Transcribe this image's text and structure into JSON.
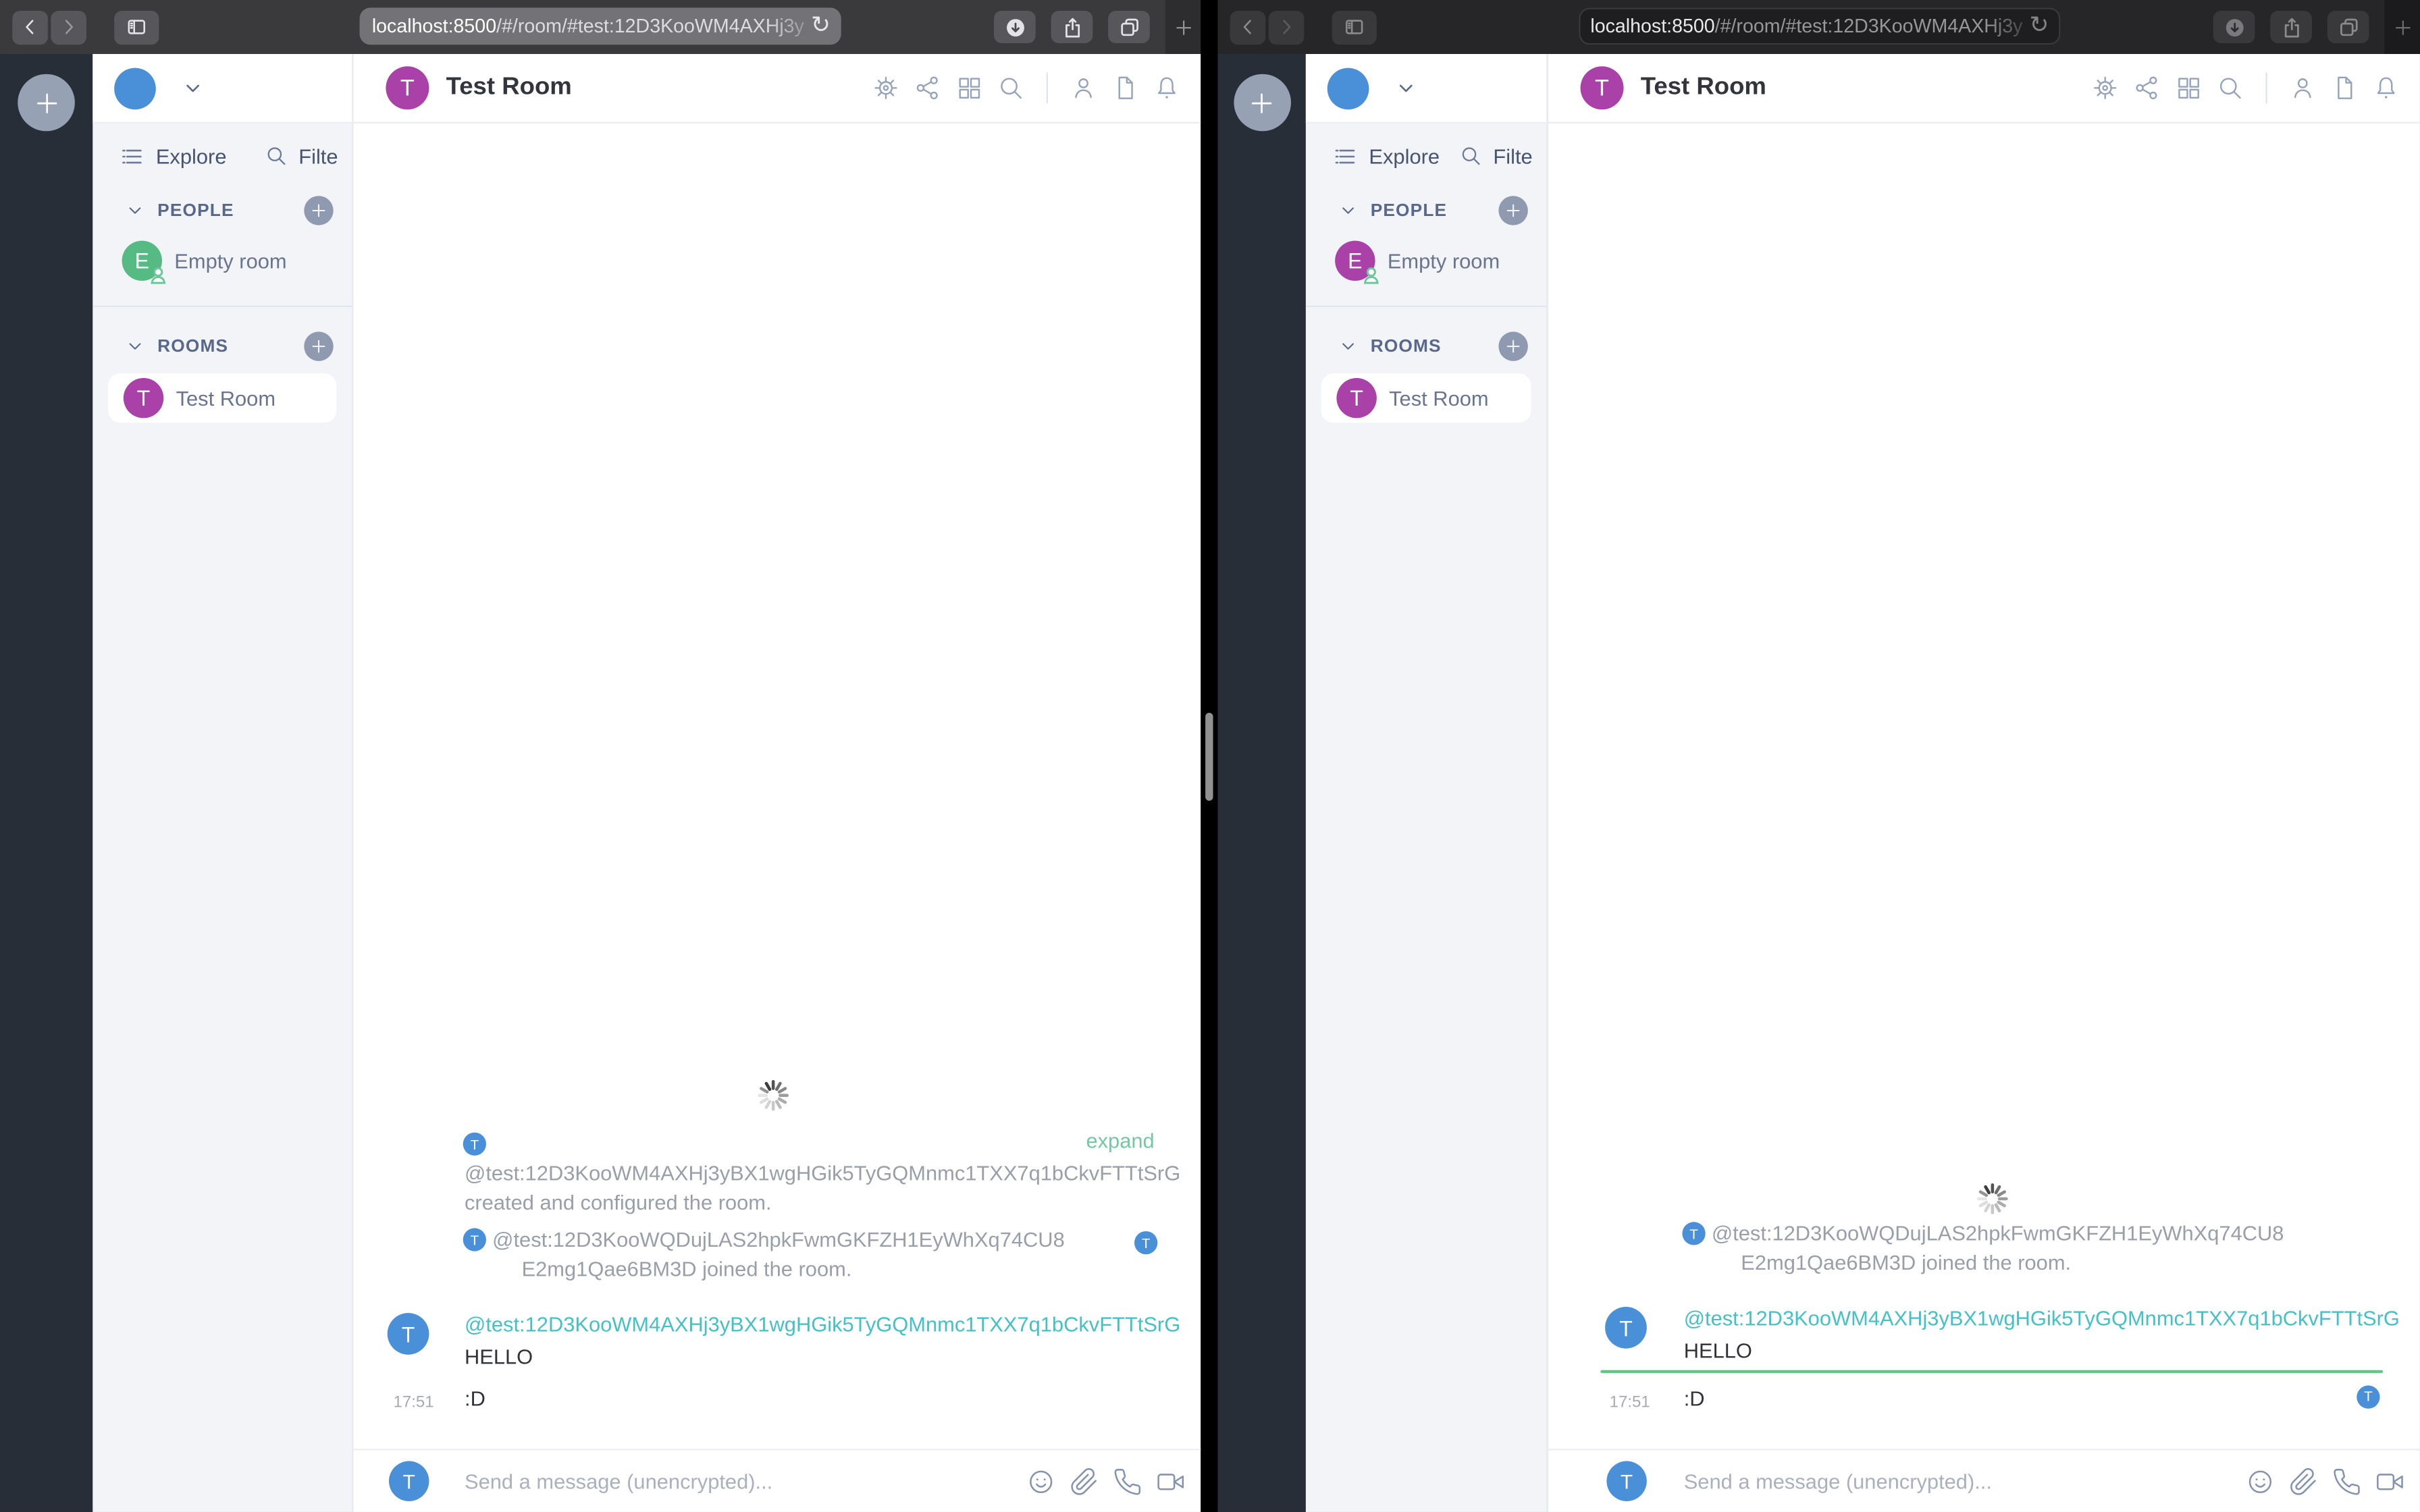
{
  "chrome": {
    "url_prefix": "localhost:8500",
    "url_rest": "/#/room/#test:12D3KooWM4AXHj3y",
    "reload_glyph": "↻"
  },
  "colors": {
    "avatar_blue": "#4a90d9",
    "avatar_purple": "#aa41a8",
    "avatar_green": "#55bb83",
    "sender_teal": "#45c1c5",
    "expand_green": "#74c9a3",
    "unread_marker_green": "#63c687",
    "sidebar_bg": "#f2f4f8",
    "rail_bg": "#282e38"
  },
  "windows": [
    {
      "side": "left",
      "sidebar": {
        "explore_label": "Explore",
        "filter_label": "Filte",
        "people_label": "PEOPLE",
        "rooms_label": "ROOMS",
        "dm": {
          "name": "Empty room",
          "avatar_letter": "E",
          "avatar_color": "#55bb83"
        },
        "room": {
          "name": "Test Room",
          "avatar_letter": "T",
          "avatar_color": "#aa41a8"
        }
      },
      "header": {
        "room_name": "Test Room",
        "avatar_letter": "T"
      },
      "timeline": {
        "created_event": {
          "avatar_letter": "T",
          "expand_label": "expand",
          "line1": "@test:12D3KooWM4AXHj3yBX1wgHGik5TyGQMnmc1TXX7q1bCkvFTTtSrG",
          "line2": "created and configured the room."
        },
        "join_event": {
          "avatar_letter": "T",
          "line1": "@test:12D3KooWQDujLAS2hpkFwmGKFZH1EyWhXq74CU8",
          "line2": "E2mg1Qae6BM3D joined the room.",
          "receipt_letter": "T"
        },
        "message": {
          "avatar_letter": "T",
          "sender": "@test:12D3KooWM4AXHj3yBX1wgHGik5TyGQMnmc1TXX7q1bCkvFTTtSrG",
          "body": "HELLO"
        },
        "message2": {
          "time": "17:51",
          "body": ":D"
        }
      },
      "composer": {
        "avatar_letter": "T",
        "placeholder": "Send a message (unencrypted)..."
      }
    },
    {
      "side": "right",
      "sidebar": {
        "explore_label": "Explore",
        "filter_label": "Filte",
        "people_label": "PEOPLE",
        "rooms_label": "ROOMS",
        "dm": {
          "name": "Empty room",
          "avatar_letter": "E",
          "avatar_color": "#aa41a8"
        },
        "room": {
          "name": "Test Room",
          "avatar_letter": "T",
          "avatar_color": "#aa41a8"
        }
      },
      "header": {
        "room_name": "Test Room",
        "avatar_letter": "T"
      },
      "timeline": {
        "join_event": {
          "avatar_letter": "T",
          "line1": "@test:12D3KooWQDujLAS2hpkFwmGKFZH1EyWhXq74CU8",
          "line2": "E2mg1Qae6BM3D joined the room."
        },
        "message": {
          "avatar_letter": "T",
          "sender": "@test:12D3KooWM4AXHj3yBX1wgHGik5TyGQMnmc1TXX7q1bCkvFTTtSrG",
          "body": "HELLO"
        },
        "message2": {
          "time": "17:51",
          "body": ":D",
          "receipt_letter": "T"
        }
      },
      "composer": {
        "avatar_letter": "T",
        "placeholder": "Send a message (unencrypted)..."
      }
    }
  ]
}
